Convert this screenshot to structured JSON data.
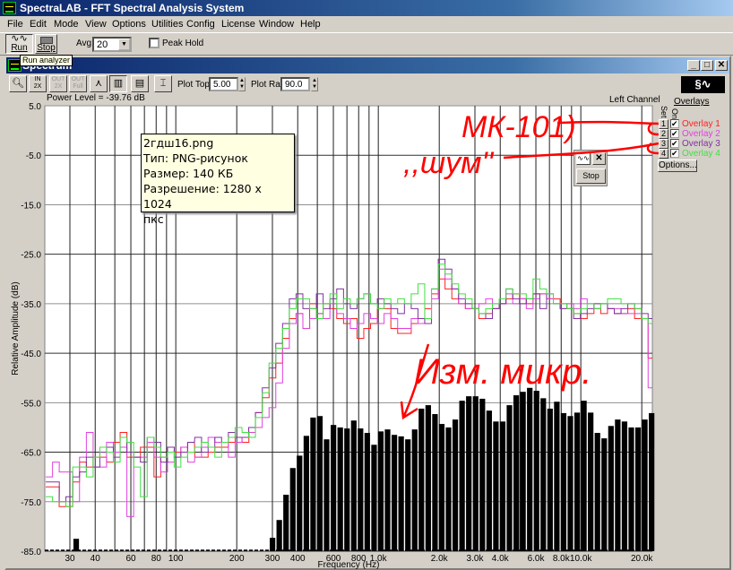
{
  "app": {
    "title": "SpectraLAB - FFT Spectral Analysis System"
  },
  "menu": [
    "File",
    "Edit",
    "Mode",
    "View",
    "Options",
    "Utilities",
    "Config",
    "License",
    "Window",
    "Help"
  ],
  "toolbar": {
    "run_label": "Run",
    "stop_label": "Stop",
    "avg_label": "Avg:",
    "avg_value": "20",
    "peak_hold_label": "Peak Hold",
    "peak_hold_checked": false,
    "run_tooltip": "Run analyzer"
  },
  "spectrum_window": {
    "title": "Spectrum",
    "plot_top_label": "Plot Top:",
    "plot_top_value": "5.00",
    "plot_range_label": "Plot Range:",
    "plot_range_value": "90.0",
    "power_level": "Power Level = -39.76 dB",
    "channel": "Left Channel"
  },
  "overlays": {
    "title": "Overlays",
    "set_label": "Set",
    "on_label": "On",
    "items": [
      {
        "set": "1",
        "label": "Overlay 1",
        "color": "#ff2020",
        "on": true
      },
      {
        "set": "2",
        "label": "Overlay 2",
        "color": "#e040e0",
        "on": true
      },
      {
        "set": "3",
        "label": "Overlay 3",
        "color": "#8030a0",
        "on": true
      },
      {
        "set": "4",
        "label": "Overlay 4",
        "color": "#40e040",
        "on": true
      }
    ],
    "options_label": "Options..."
  },
  "float_widget": {
    "stop_label": "Stop"
  },
  "file_tooltip": [
    "2гдш16.png",
    "Тип: PNG-рисунок",
    "Размер: 140 КБ",
    "Разрешение: 1280 x 1024",
    "пкс"
  ],
  "annotations": {
    "mk101": "МК-101)",
    "noise": ",,шум''",
    "measured": "Изм. микр.",
    "color": "#ff0000"
  },
  "chart_data": {
    "type": "bar",
    "xlabel": "Frequency (Hz)",
    "ylabel": "Relative Amplitude (dB)",
    "x_scale": "log",
    "ylim": [
      -85,
      5
    ],
    "xlim_hz": [
      22.5,
      22700
    ],
    "grid": true,
    "y_ticks": [
      "5.0",
      "-5.0",
      "-15.0",
      "-25.0",
      "-35.0",
      "-45.0",
      "-55.0",
      "-65.0",
      "-75.0",
      "-85.0"
    ],
    "y_tick_values": [
      5,
      -5,
      -15,
      -25,
      -35,
      -45,
      -55,
      -65,
      -75,
      -85
    ],
    "x_ticks": [
      {
        "f": 30,
        "label": "30"
      },
      {
        "f": 40,
        "label": "40"
      },
      {
        "f": 60,
        "label": "60"
      },
      {
        "f": 80,
        "label": "80"
      },
      {
        "f": 100,
        "label": "100"
      },
      {
        "f": 200,
        "label": "200"
      },
      {
        "f": 300,
        "label": "300"
      },
      {
        "f": 400,
        "label": "400"
      },
      {
        "f": 600,
        "label": "600"
      },
      {
        "f": 800,
        "label": "800"
      },
      {
        "f": 1000,
        "label": "1.0k"
      },
      {
        "f": 2000,
        "label": "2.0k"
      },
      {
        "f": 3000,
        "label": "3.0k"
      },
      {
        "f": 4000,
        "label": "4.0k"
      },
      {
        "f": 6000,
        "label": "6.0k"
      },
      {
        "f": 8000,
        "label": "8.0k"
      },
      {
        "f": 10000,
        "label": "10.0k"
      },
      {
        "f": 20000,
        "label": "20.0k"
      }
    ],
    "x_gridlines_hz": [
      30,
      40,
      50,
      60,
      70,
      80,
      90,
      100,
      200,
      300,
      400,
      500,
      600,
      700,
      800,
      900,
      1000,
      2000,
      3000,
      4000,
      5000,
      6000,
      7000,
      8000,
      9000,
      10000,
      20000
    ],
    "bin_freqs_hz": [
      23.7,
      25.6,
      27.6,
      29.8,
      32.2,
      34.8,
      37.6,
      40.6,
      43.8,
      47.3,
      51.1,
      55.2,
      59.6,
      64.4,
      69.5,
      75.1,
      81.1,
      87.6,
      94.6,
      102,
      110,
      119,
      129,
      139,
      150,
      162,
      175,
      189,
      204,
      221,
      238,
      257,
      278,
      300,
      324,
      350,
      378,
      408,
      441,
      476,
      514,
      555,
      600,
      648,
      700,
      756,
      816,
      881,
      952,
      1028,
      1110,
      1199,
      1295,
      1399,
      1511,
      1631,
      1762,
      1903,
      2055,
      2220,
      2397,
      2589,
      2796,
      3020,
      3262,
      3523,
      3804,
      4109,
      4437,
      4792,
      5176,
      5590,
      6037,
      6520,
      7042,
      7605,
      8213,
      8870,
      9580,
      10346,
      11174,
      12068,
      13033,
      14076,
      15202,
      16418,
      17732,
      19150,
      20682,
      22337
    ],
    "bars_color": "#000000",
    "bars": [
      -85,
      -85,
      -85,
      -85,
      -82.5,
      -85,
      -85,
      -85,
      -85,
      -85,
      -85,
      -85,
      -85,
      -85,
      -85,
      -85,
      -85,
      -85,
      -85,
      -85,
      -85,
      -85,
      -85,
      -85,
      -85,
      -85,
      -85,
      -85,
      -85,
      -85,
      -85,
      -85,
      -85,
      -82.3,
      -78.7,
      -73.6,
      -68.2,
      -65.7,
      -61.7,
      -58.0,
      -57.7,
      -62.4,
      -59.5,
      -60.0,
      -60.2,
      -58.6,
      -60.2,
      -61.1,
      -63.5,
      -60.8,
      -60.4,
      -61.5,
      -61.8,
      -62.4,
      -60.4,
      -56.2,
      -55.5,
      -57.3,
      -59.3,
      -60.0,
      -58.4,
      -54.6,
      -53.7,
      -53.7,
      -54.2,
      -56.6,
      -58.8,
      -58.8,
      -55.5,
      -53.5,
      -52.8,
      -52.0,
      -52.6,
      -54.1,
      -56.2,
      -54.8,
      -57.1,
      -57.7,
      -57.0,
      -54.6,
      -57.0,
      -61.1,
      -62.2,
      -59.7,
      -58.4,
      -58.8,
      -60.0,
      -60.0,
      -58.4,
      -57.1
    ],
    "series": [
      {
        "name": "Overlay 1",
        "color": "#ff2020",
        "values": [
          -72,
          -72,
          -76,
          -76,
          -71,
          -67,
          -68,
          -66,
          -66,
          -67,
          -63,
          -61,
          -66,
          -66,
          -64,
          -64,
          -70,
          -66,
          -64,
          -65,
          -64,
          -63,
          -66,
          -66,
          -65,
          -64,
          -64,
          -63,
          -62,
          -63,
          -60,
          -57,
          -54,
          -50,
          -47,
          -42,
          -38,
          -37,
          -40,
          -35,
          -37,
          -35,
          -36,
          -38,
          -39,
          -38,
          -42,
          -40,
          -39,
          -36,
          -36,
          -40,
          -41,
          -41,
          -39,
          -39,
          -36,
          -33,
          -30,
          -32,
          -34,
          -35,
          -36,
          -36,
          -38,
          -37,
          -36,
          -35,
          -34,
          -33,
          -34,
          -35,
          -33,
          -33,
          -34,
          -34,
          -35,
          -36,
          -37,
          -38,
          -37,
          -36,
          -37,
          -36,
          -37,
          -37,
          -36,
          -38,
          -38,
          -46
        ]
      },
      {
        "name": "Overlay 2",
        "color": "#e040e0",
        "values": [
          -70,
          -67,
          -69,
          -69,
          -75,
          -66,
          -61,
          -68,
          -68,
          -63,
          -65,
          -64,
          -78,
          -66,
          -66,
          -63,
          -66,
          -69,
          -67,
          -66,
          -64,
          -67,
          -66,
          -64,
          -62,
          -63,
          -63,
          -66,
          -63,
          -62,
          -61,
          -60,
          -58,
          -56,
          -51,
          -44,
          -39,
          -37,
          -40,
          -38,
          -37,
          -38,
          -35,
          -37,
          -38,
          -40,
          -39,
          -37,
          -38,
          -39,
          -37,
          -38,
          -40,
          -40,
          -38,
          -39,
          -38,
          -34,
          -28,
          -30,
          -32,
          -35,
          -36,
          -36,
          -35,
          -34,
          -36,
          -35,
          -33,
          -35,
          -34,
          -36,
          -34,
          -33,
          -34,
          -35,
          -36,
          -35,
          -36,
          -34,
          -35,
          -36,
          -35,
          -36,
          -36,
          -37,
          -37,
          -37,
          -38,
          -52
        ]
      },
      {
        "name": "Overlay 3",
        "color": "#8030a0",
        "values": [
          -71,
          -71,
          -75,
          -74,
          -70,
          -69,
          -66,
          -68,
          -65,
          -64,
          -66,
          -62,
          -65,
          -66,
          -67,
          -62,
          -63,
          -67,
          -64,
          -66,
          -65,
          -63,
          -62,
          -65,
          -64,
          -62,
          -63,
          -61,
          -62,
          -62,
          -60,
          -57,
          -52,
          -48,
          -43,
          -39,
          -34,
          -33,
          -36,
          -36,
          -33,
          -36,
          -34,
          -32,
          -35,
          -36,
          -34,
          -33,
          -35,
          -34,
          -35,
          -36,
          -37,
          -35,
          -36,
          -38,
          -39,
          -32,
          -26,
          -28,
          -32,
          -34,
          -35,
          -36,
          -37,
          -38,
          -36,
          -35,
          -32,
          -34,
          -35,
          -34,
          -33,
          -36,
          -33,
          -35,
          -36,
          -36,
          -38,
          -37,
          -36,
          -35,
          -35,
          -36,
          -37,
          -36,
          -35,
          -36,
          -37,
          -38
        ]
      },
      {
        "name": "Overlay 4",
        "color": "#40e040",
        "values": [
          -74,
          -75,
          -75,
          -76,
          -68,
          -68,
          -70,
          -66,
          -64,
          -65,
          -67,
          -62,
          -63,
          -68,
          -74,
          -62,
          -64,
          -66,
          -65,
          -68,
          -66,
          -65,
          -64,
          -63,
          -64,
          -66,
          -63,
          -62,
          -60,
          -61,
          -62,
          -58,
          -53,
          -47,
          -44,
          -40,
          -36,
          -34,
          -34,
          -36,
          -38,
          -35,
          -33,
          -36,
          -34,
          -35,
          -34,
          -33,
          -35,
          -36,
          -34,
          -35,
          -34,
          -35,
          -33,
          -31,
          -38,
          -32,
          -27,
          -29,
          -31,
          -33,
          -34,
          -36,
          -37,
          -36,
          -35,
          -34,
          -32,
          -33,
          -33,
          -34,
          -30,
          -32,
          -33,
          -35,
          -35,
          -36,
          -37,
          -36,
          -35,
          -36,
          -35,
          -34,
          -34,
          -35,
          -35,
          -36,
          -38,
          -39
        ]
      }
    ]
  }
}
